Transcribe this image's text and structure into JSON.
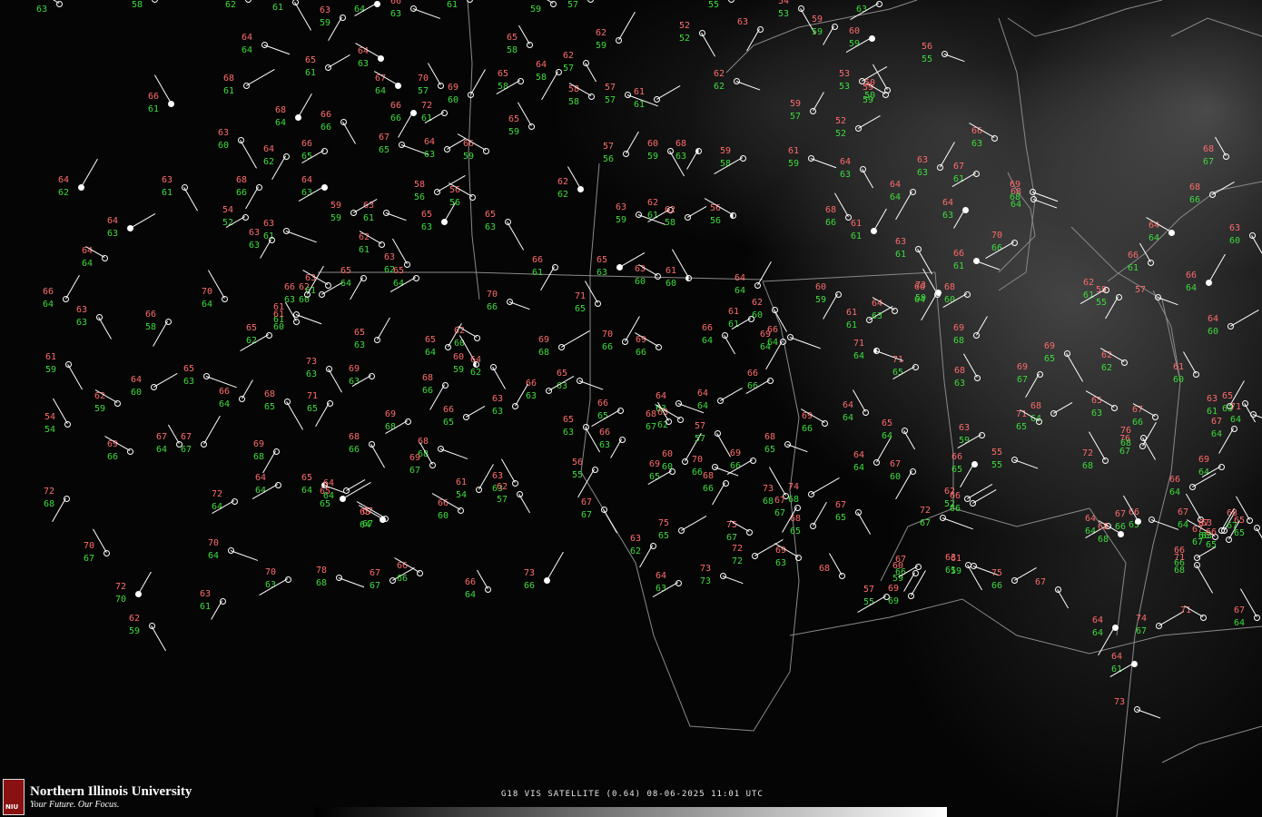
{
  "caption": "G18 VIS SATELLITE (0.64) 08-06-2025 11:01 UTC",
  "logo": {
    "name": "Northern Illinois University",
    "tagline": "Your Future. Our Focus.",
    "mark": "NIU"
  },
  "colors": {
    "temperature": "#ff6b6b",
    "dewpoint": "#3cdc3c",
    "barb": "#ffffff",
    "boundaries": "#8a8a8a"
  },
  "stations": [
    {
      "t": "63",
      "d": "63",
      "c": "none"
    },
    {
      "t": "",
      "d": "58",
      "c": "none"
    },
    {
      "t": "",
      "d": "62",
      "c": "none"
    },
    {
      "t": "",
      "d": "61",
      "c": "none"
    },
    {
      "t": "63",
      "d": "59",
      "c": "none"
    },
    {
      "t": "",
      "d": "64",
      "c": "full"
    },
    {
      "t": "66",
      "d": "63",
      "c": "none"
    },
    {
      "t": "",
      "d": "61",
      "c": "none"
    },
    {
      "t": "",
      "d": "59",
      "c": "none"
    },
    {
      "t": "",
      "d": "57",
      "c": "none"
    },
    {
      "t": "",
      "d": "55",
      "c": "none"
    },
    {
      "t": "54",
      "d": "53",
      "c": "none"
    },
    {
      "t": "59",
      "d": "59",
      "c": "none"
    },
    {
      "t": "66",
      "d": "63",
      "c": "none"
    },
    {
      "t": "64",
      "d": "64",
      "c": "none"
    },
    {
      "t": "65",
      "d": "61",
      "c": "none"
    },
    {
      "t": "64",
      "d": "63",
      "c": "full"
    },
    {
      "t": "65",
      "d": "58",
      "c": "none"
    },
    {
      "t": "62",
      "d": "59",
      "c": "none"
    },
    {
      "t": "52",
      "d": "52",
      "c": "none"
    },
    {
      "t": "63",
      "d": "",
      "c": "none"
    },
    {
      "t": "60",
      "d": "59",
      "c": "full"
    },
    {
      "t": "56",
      "d": "55",
      "c": "none"
    },
    {
      "t": "68",
      "d": "61",
      "c": "none"
    },
    {
      "t": "67",
      "d": "64",
      "c": "full"
    },
    {
      "t": "70",
      "d": "57",
      "c": "none"
    },
    {
      "t": "69",
      "d": "60",
      "c": "none"
    },
    {
      "t": "62",
      "d": "57",
      "c": "none"
    },
    {
      "t": "64",
      "d": "58",
      "c": "none"
    },
    {
      "t": "65",
      "d": "58",
      "c": "none"
    },
    {
      "t": "62",
      "d": "62",
      "c": "none"
    },
    {
      "t": "53",
      "d": "53",
      "c": "none"
    },
    {
      "t": "59",
      "d": "59",
      "c": "none"
    },
    {
      "t": "66",
      "d": "61",
      "c": "full"
    },
    {
      "t": "68",
      "d": "64",
      "c": "full"
    },
    {
      "t": "66",
      "d": "66",
      "c": "none"
    },
    {
      "t": "66",
      "d": "66",
      "c": "full"
    },
    {
      "t": "72",
      "d": "61",
      "c": "none"
    },
    {
      "t": "57",
      "d": "57",
      "c": "none"
    },
    {
      "t": "61",
      "d": "61",
      "c": "none"
    },
    {
      "t": "58",
      "d": "58",
      "c": "none"
    },
    {
      "t": "50",
      "d": "50",
      "c": "none"
    },
    {
      "t": "59",
      "d": "57",
      "c": "none"
    },
    {
      "t": "63",
      "d": "60",
      "c": "none"
    },
    {
      "t": "64",
      "d": "62",
      "c": "none"
    },
    {
      "t": "66",
      "d": "65",
      "c": "none"
    },
    {
      "t": "67",
      "d": "65",
      "c": "none"
    },
    {
      "t": "64",
      "d": "63",
      "c": "none"
    },
    {
      "t": "66",
      "d": "59",
      "c": "none"
    },
    {
      "t": "65",
      "d": "59",
      "c": "none"
    },
    {
      "t": "57",
      "d": "56",
      "c": "none"
    },
    {
      "t": "60",
      "d": "59",
      "c": "none"
    },
    {
      "t": "68",
      "d": "63",
      "c": "half"
    },
    {
      "t": "59",
      "d": "58",
      "c": "none"
    },
    {
      "t": "61",
      "d": "59",
      "c": "none"
    },
    {
      "t": "52",
      "d": "52",
      "c": "none"
    },
    {
      "t": "66",
      "d": "63",
      "c": "none"
    },
    {
      "t": "68",
      "d": "67",
      "c": "none"
    },
    {
      "t": "64",
      "d": "62",
      "c": "full"
    },
    {
      "t": "63",
      "d": "61",
      "c": "none"
    },
    {
      "t": "68",
      "d": "66",
      "c": "none"
    },
    {
      "t": "64",
      "d": "63",
      "c": "full"
    },
    {
      "t": "63",
      "d": "61",
      "c": "none"
    },
    {
      "t": "58",
      "d": "56",
      "c": "none"
    },
    {
      "t": "56",
      "d": "56",
      "c": "none"
    },
    {
      "t": "62",
      "d": "62",
      "c": "full"
    },
    {
      "t": "63",
      "d": "63",
      "c": "none"
    },
    {
      "t": "64",
      "d": "63",
      "c": "none"
    },
    {
      "t": "64",
      "d": "64",
      "c": "none"
    },
    {
      "t": "67",
      "d": "61",
      "c": "none"
    },
    {
      "t": "68",
      "d": "64",
      "c": "none"
    },
    {
      "t": "64",
      "d": "63",
      "c": "full"
    },
    {
      "t": "64",
      "d": "64",
      "c": "none"
    },
    {
      "t": "70",
      "d": "64",
      "c": "none"
    },
    {
      "t": "66",
      "d": "64",
      "c": "none"
    },
    {
      "t": "63",
      "d": "63",
      "c": "none"
    },
    {
      "t": "66",
      "d": "58",
      "c": "none"
    },
    {
      "t": "54",
      "d": "52",
      "c": "none"
    },
    {
      "t": "63",
      "d": "61",
      "c": "none"
    },
    {
      "t": "59",
      "d": "59",
      "c": "none"
    },
    {
      "t": "62",
      "d": "61",
      "c": "none"
    },
    {
      "t": "63",
      "d": "62",
      "c": "none"
    },
    {
      "t": "65",
      "d": "63",
      "c": "full"
    },
    {
      "t": "65",
      "d": "63",
      "c": "none"
    },
    {
      "t": "66",
      "d": "61",
      "c": "none"
    },
    {
      "t": "62",
      "d": "61",
      "c": "none"
    },
    {
      "t": "63",
      "d": "59",
      "c": "none"
    },
    {
      "t": "62",
      "d": "58",
      "c": "none"
    },
    {
      "t": "56",
      "d": "56",
      "c": "half"
    },
    {
      "t": "68",
      "d": "66",
      "c": "none"
    },
    {
      "t": "61",
      "d": "61",
      "c": "full"
    },
    {
      "t": "63",
      "d": "61",
      "c": "none"
    },
    {
      "t": "64",
      "d": "63",
      "c": "full"
    },
    {
      "t": "70",
      "d": "66",
      "c": "none"
    },
    {
      "t": "69",
      "d": "68",
      "c": "none"
    },
    {
      "t": "68",
      "d": "66",
      "c": "none"
    },
    {
      "t": "64",
      "d": "64",
      "c": "full"
    },
    {
      "t": "66",
      "d": "61",
      "c": "none"
    },
    {
      "t": "66",
      "d": "64",
      "c": "full"
    },
    {
      "t": "63",
      "d": "60",
      "c": "none"
    },
    {
      "t": "59",
      "d": "55",
      "c": "none"
    },
    {
      "t": "62",
      "d": "61",
      "c": "none"
    },
    {
      "t": "57",
      "d": "",
      "c": "none"
    },
    {
      "t": "64",
      "d": "60",
      "c": "none"
    },
    {
      "t": "62",
      "d": "62",
      "c": "none"
    },
    {
      "t": "61",
      "d": "60",
      "c": "none"
    },
    {
      "t": "63",
      "d": "61",
      "c": "none"
    },
    {
      "t": "65",
      "d": "63",
      "c": "none"
    },
    {
      "t": "73",
      "d": "59",
      "c": "full"
    },
    {
      "t": "68",
      "d": "60",
      "c": "none"
    },
    {
      "t": "66",
      "d": "61",
      "c": "full"
    },
    {
      "t": "65",
      "d": "63",
      "c": "full"
    },
    {
      "t": "63",
      "d": "60",
      "c": "none"
    },
    {
      "t": "61",
      "d": "60",
      "c": "half"
    },
    {
      "t": "64",
      "d": "64",
      "c": "none"
    },
    {
      "t": "62",
      "d": "60",
      "c": "none"
    },
    {
      "t": "60",
      "d": "59",
      "c": "none"
    },
    {
      "t": "61",
      "d": "61",
      "c": "none"
    },
    {
      "t": "66",
      "d": "64",
      "c": "none"
    },
    {
      "t": "61",
      "d": "61",
      "c": "none"
    },
    {
      "t": "64",
      "d": "63",
      "c": "none"
    },
    {
      "t": "66",
      "d": "64",
      "c": "none"
    },
    {
      "t": "69",
      "d": "68",
      "c": "none"
    },
    {
      "t": "69",
      "d": "65",
      "c": "none"
    },
    {
      "t": "69",
      "d": "67",
      "c": "none"
    },
    {
      "t": "71",
      "d": "65",
      "c": "none"
    },
    {
      "t": "71",
      "d": "64",
      "c": "half"
    },
    {
      "t": "68",
      "d": "64",
      "c": "none"
    },
    {
      "t": "65",
      "d": "63",
      "c": "none"
    },
    {
      "t": "68",
      "d": "63",
      "c": "none"
    },
    {
      "t": "65",
      "d": "63",
      "c": "none"
    },
    {
      "t": "61",
      "d": "59",
      "c": "none"
    },
    {
      "t": "63",
      "d": "63",
      "c": "none"
    },
    {
      "t": "65",
      "d": "62",
      "c": "none"
    },
    {
      "t": "61",
      "d": "61",
      "c": "none"
    },
    {
      "t": "62",
      "d": "60",
      "c": "none"
    },
    {
      "t": "63",
      "d": "61",
      "c": "none"
    },
    {
      "t": "61",
      "d": "60",
      "c": "none"
    },
    {
      "t": "66",
      "d": "63",
      "c": "none"
    },
    {
      "t": "73",
      "d": "63",
      "c": "none"
    },
    {
      "t": "65",
      "d": "64",
      "c": "none"
    },
    {
      "t": "65",
      "d": "64",
      "c": "none"
    },
    {
      "t": "70",
      "d": "66",
      "c": "none"
    },
    {
      "t": "69",
      "d": "68",
      "c": "none"
    },
    {
      "t": "69",
      "d": "66",
      "c": "none"
    },
    {
      "t": "71",
      "d": "65",
      "c": "none"
    },
    {
      "t": "70",
      "d": "66",
      "c": "none"
    },
    {
      "t": "66",
      "d": "64",
      "c": "none"
    },
    {
      "t": "69",
      "d": "64",
      "c": "none"
    },
    {
      "t": "66",
      "d": "66",
      "c": "none"
    },
    {
      "t": "65",
      "d": "63",
      "c": "none"
    },
    {
      "t": "66",
      "d": "63",
      "c": "none"
    },
    {
      "t": "62",
      "d": "60",
      "c": "none"
    },
    {
      "t": "60",
      "d": "59",
      "c": "half"
    },
    {
      "t": "65",
      "d": "64",
      "c": "none"
    },
    {
      "t": "64",
      "d": "62",
      "c": "none"
    },
    {
      "t": "68",
      "d": "66",
      "c": "none"
    },
    {
      "t": "69",
      "d": "63",
      "c": "none"
    },
    {
      "t": "65",
      "d": "63",
      "c": "none"
    },
    {
      "t": "64",
      "d": "60",
      "c": "none"
    },
    {
      "t": "62",
      "d": "59",
      "c": "none"
    },
    {
      "t": "54",
      "d": "54",
      "c": "none"
    },
    {
      "t": "66",
      "d": "64",
      "c": "none"
    },
    {
      "t": "68",
      "d": "65",
      "c": "none"
    },
    {
      "t": "71",
      "d": "65",
      "c": "none"
    },
    {
      "t": "69",
      "d": "68",
      "c": "none"
    },
    {
      "t": "68",
      "d": "68",
      "c": "none"
    },
    {
      "t": "66",
      "d": "65",
      "c": "none"
    },
    {
      "t": "66",
      "d": "60",
      "c": "none"
    },
    {
      "t": "63",
      "d": "63",
      "c": "none"
    },
    {
      "t": "63",
      "d": "63",
      "c": "none"
    },
    {
      "t": "65",
      "d": "63",
      "c": "none"
    },
    {
      "t": "66",
      "d": "63",
      "c": "none"
    },
    {
      "t": "66",
      "d": "65",
      "c": "none"
    },
    {
      "t": "64",
      "d": "63",
      "c": "none"
    },
    {
      "t": "64",
      "d": "64",
      "c": "none"
    },
    {
      "t": "63",
      "d": "62",
      "c": "none"
    },
    {
      "t": "68",
      "d": "67",
      "c": "none"
    },
    {
      "t": "60",
      "d": "60",
      "c": "none"
    },
    {
      "t": "57",
      "d": "57",
      "c": "none"
    },
    {
      "t": "68",
      "d": "66",
      "c": "none"
    },
    {
      "t": "69",
      "d": "66",
      "c": "none"
    },
    {
      "t": "68",
      "d": "65",
      "c": "none"
    },
    {
      "t": "74",
      "d": "68",
      "c": "none"
    },
    {
      "t": "69",
      "d": "66",
      "c": "none"
    },
    {
      "t": "64",
      "d": "64",
      "c": "none"
    },
    {
      "t": "64",
      "d": "64",
      "c": "none"
    },
    {
      "t": "65",
      "d": "64",
      "c": "none"
    },
    {
      "t": "67",
      "d": "60",
      "c": "none"
    },
    {
      "t": "63",
      "d": "59",
      "c": "none"
    },
    {
      "t": "55",
      "d": "55",
      "c": "none"
    },
    {
      "t": "62",
      "d": "52",
      "c": "none"
    },
    {
      "t": "71",
      "d": "65",
      "c": "none"
    },
    {
      "t": "72",
      "d": "68",
      "c": "none"
    },
    {
      "t": "76",
      "d": "67",
      "c": "none"
    },
    {
      "t": "76",
      "d": "68",
      "c": "none"
    },
    {
      "t": "67",
      "d": "64",
      "c": "none"
    },
    {
      "t": "69",
      "d": "64",
      "c": "none"
    },
    {
      "t": "71",
      "d": "64",
      "c": "none"
    },
    {
      "t": "66",
      "d": "64",
      "c": "none"
    },
    {
      "t": "67",
      "d": "66",
      "c": "none"
    },
    {
      "t": "67",
      "d": "64",
      "c": "none"
    },
    {
      "t": "63",
      "d": "63",
      "c": "none"
    },
    {
      "t": "65",
      "d": "65",
      "c": "none"
    },
    {
      "t": "66",
      "d": "65",
      "c": "full"
    },
    {
      "t": "64",
      "d": "64",
      "c": "none"
    },
    {
      "t": "66",
      "d": "65",
      "c": "none"
    },
    {
      "t": "66",
      "d": "66",
      "c": "none"
    },
    {
      "t": "67",
      "d": "67",
      "c": "none"
    },
    {
      "t": "68",
      "d": "67",
      "c": "none"
    },
    {
      "t": "67",
      "d": "66",
      "c": "none"
    },
    {
      "t": "63",
      "d": "61",
      "c": "none"
    },
    {
      "t": "60",
      "d": "59",
      "c": "none"
    },
    {
      "t": "57",
      "d": "55",
      "c": "none"
    },
    {
      "t": "61",
      "d": "59",
      "c": "none"
    },
    {
      "t": "75",
      "d": "66",
      "c": "none"
    },
    {
      "t": "69",
      "d": "66",
      "c": "none"
    },
    {
      "t": "67",
      "d": "64",
      "c": "none"
    },
    {
      "t": "67",
      "d": "67",
      "c": "none"
    },
    {
      "t": "68",
      "d": "66",
      "c": "none"
    },
    {
      "t": "69",
      "d": "68",
      "c": "none"
    },
    {
      "t": "64",
      "d": "64",
      "c": "none"
    },
    {
      "t": "65",
      "d": "64",
      "c": "half"
    },
    {
      "t": "65",
      "d": "65",
      "c": "full"
    },
    {
      "t": "65",
      "d": "64",
      "c": "full"
    },
    {
      "t": "69",
      "d": "67",
      "c": "none"
    },
    {
      "t": "61",
      "d": "54",
      "c": "none"
    },
    {
      "t": "62",
      "d": "57",
      "c": "none"
    },
    {
      "t": "56",
      "d": "55",
      "c": "none"
    },
    {
      "t": "69",
      "d": "65",
      "c": "none"
    },
    {
      "t": "70",
      "d": "66",
      "c": "none"
    },
    {
      "t": "75",
      "d": "65",
      "c": "none"
    },
    {
      "t": "75",
      "d": "67",
      "c": "none"
    },
    {
      "t": "73",
      "d": "68",
      "c": "none"
    },
    {
      "t": "68",
      "d": "65",
      "c": "none"
    },
    {
      "t": "67",
      "d": "65",
      "c": "none"
    },
    {
      "t": "67",
      "d": "67",
      "c": "none"
    },
    {
      "t": "67",
      "d": "66",
      "c": "none"
    },
    {
      "t": "72",
      "d": "67",
      "c": "none"
    },
    {
      "t": "66",
      "d": "66",
      "c": "none"
    },
    {
      "t": "68",
      "d": "68",
      "c": "full"
    },
    {
      "t": "67",
      "d": "66",
      "c": "full"
    },
    {
      "t": "66",
      "d": "65",
      "c": "none"
    },
    {
      "t": "71",
      "d": "68",
      "c": "none"
    },
    {
      "t": "72",
      "d": "68",
      "c": "none"
    },
    {
      "t": "72",
      "d": "64",
      "c": "none"
    },
    {
      "t": "70",
      "d": "64",
      "c": "none"
    },
    {
      "t": "64",
      "d": "64",
      "c": "none"
    },
    {
      "t": "67",
      "d": "67",
      "c": "none"
    },
    {
      "t": "70",
      "d": "67",
      "c": "none"
    },
    {
      "t": "72",
      "d": "70",
      "c": "full"
    },
    {
      "t": "62",
      "d": "59",
      "c": "none"
    },
    {
      "t": "63",
      "d": "61",
      "c": "none"
    },
    {
      "t": "70",
      "d": "63",
      "c": "none"
    },
    {
      "t": "78",
      "d": "68",
      "c": "none"
    },
    {
      "t": "67",
      "d": "67",
      "c": "none"
    },
    {
      "t": "66",
      "d": "66",
      "c": "none"
    },
    {
      "t": "66",
      "d": "64",
      "c": "none"
    },
    {
      "t": "73",
      "d": "66",
      "c": "full"
    },
    {
      "t": "67",
      "d": "67",
      "c": "none"
    },
    {
      "t": "63",
      "d": "62",
      "c": "none"
    },
    {
      "t": "64",
      "d": "63",
      "c": "none"
    },
    {
      "t": "73",
      "d": "73",
      "c": "none"
    },
    {
      "t": "72",
      "d": "72",
      "c": "none"
    },
    {
      "t": "69",
      "d": "63",
      "c": "none"
    },
    {
      "t": "68",
      "d": "",
      "c": "none"
    },
    {
      "t": "69",
      "d": "69",
      "c": "none"
    },
    {
      "t": "67",
      "d": "",
      "c": "none"
    },
    {
      "t": "64",
      "d": "64",
      "c": "full"
    },
    {
      "t": "64",
      "d": "61",
      "c": "full"
    },
    {
      "t": "73",
      "d": "",
      "c": "none"
    },
    {
      "t": "74",
      "d": "67",
      "c": "none"
    },
    {
      "t": "71",
      "d": "",
      "c": "none"
    },
    {
      "t": "67",
      "d": "64",
      "c": "none"
    }
  ]
}
